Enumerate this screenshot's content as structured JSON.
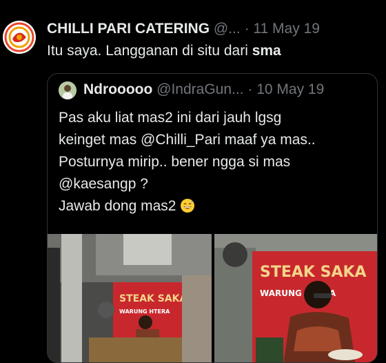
{
  "tweet": {
    "display_name": "CHILLI PARI CATERING",
    "handle": "@...",
    "separator": "·",
    "date": "11 May 19",
    "text_plain": "Itu saya. Langganan di situ dari ",
    "text_bold": "sma"
  },
  "quoted": {
    "display_name": "Ndrooooo",
    "handle": "@IndraGun...",
    "separator": "·",
    "date": "10 May 19",
    "text": "Pas aku liat mas2 ini dari jauh lgsg\nkeinget mas @Chilli_Pari maaf ya mas..\nPosturnya mirip.. bener ngga si mas\n@kaesangp ?\nJawab dong mas2 ",
    "emoji": "grinning-sweat-emoji"
  },
  "photos": {
    "left_sign_line1": "STEAK SAKAU",
    "left_sign_line2": "WARUNG  HTERA",
    "right_sign_line1": "STEAK SAKA",
    "right_sign_line2": "WARUNG  HTERA"
  },
  "colors": {
    "background": "#000000",
    "text": "#e7e9ea",
    "muted": "#71767b",
    "border": "#2f3336",
    "sign_red": "#c8282d"
  }
}
